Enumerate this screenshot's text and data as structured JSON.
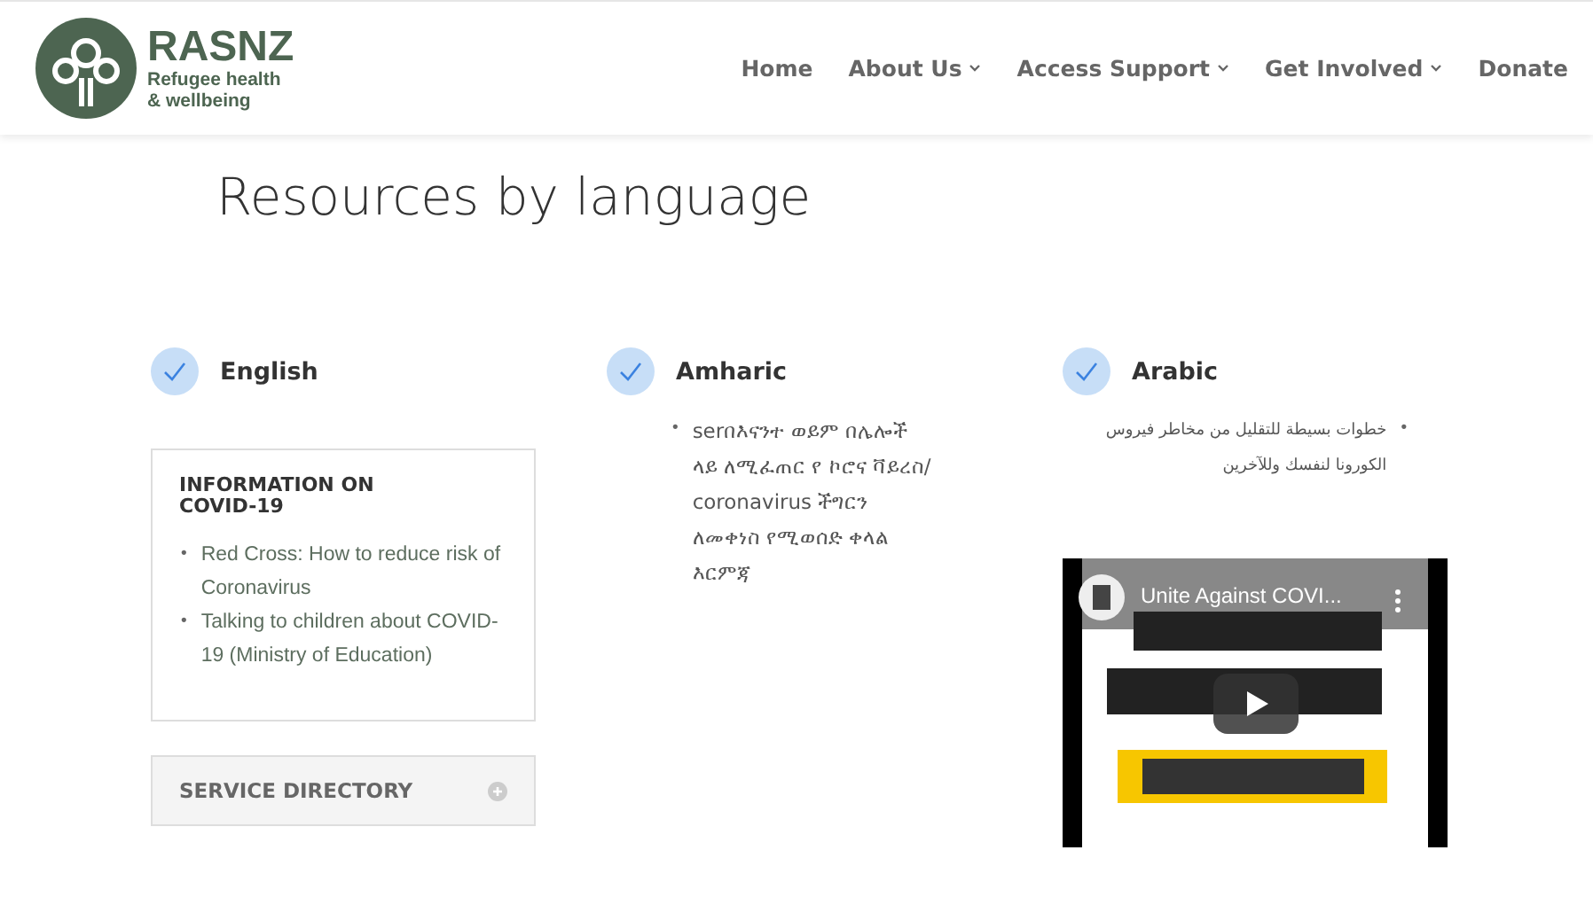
{
  "logo": {
    "name": "RASNZ",
    "tagline": "Refugee health\n& wellbeing"
  },
  "nav": [
    {
      "label": "Home",
      "dropdown": false
    },
    {
      "label": "About Us",
      "dropdown": true
    },
    {
      "label": "Access Support",
      "dropdown": true
    },
    {
      "label": "Get Involved",
      "dropdown": true
    },
    {
      "label": "Donate",
      "dropdown": false
    }
  ],
  "heading": "Resources by language",
  "columns": [
    {
      "language": "English",
      "checked": true,
      "card": {
        "title": "INFORMATION ON COVID-19",
        "items": [
          {
            "marker": "•",
            "text": "Red Cross: How to  reduce risk of Coronavirus"
          },
          {
            "marker": "•",
            "text": "Talking to children about COVID-19 (Ministry of Education)"
          }
        ]
      },
      "accordion": {
        "title": "SERVICE DIRECTORY",
        "expanded": false
      }
    },
    {
      "language": "Amharic",
      "checked": true,
      "items": [
        {
          "marker": "•",
          "text": "serበእናንተ ወይም በሌሎች ላይ ለሚፈጠር የ ኮሮና ቫይረስ/ coronavirus ችግርን ለመቀነስ የሚወሰድ ቀላል እርምጃ",
          "kind": "ltr"
        }
      ]
    },
    {
      "language": "Arabic",
      "checked": true,
      "items": [
        {
          "marker": "•",
          "text": "خطوات بسيطة للتقليل من مخاطر فيروس الكورونا لنفسك وللآخرين",
          "kind": "rtl"
        }
      ],
      "video": {
        "title": "Unite Against COVI..."
      }
    }
  ]
}
